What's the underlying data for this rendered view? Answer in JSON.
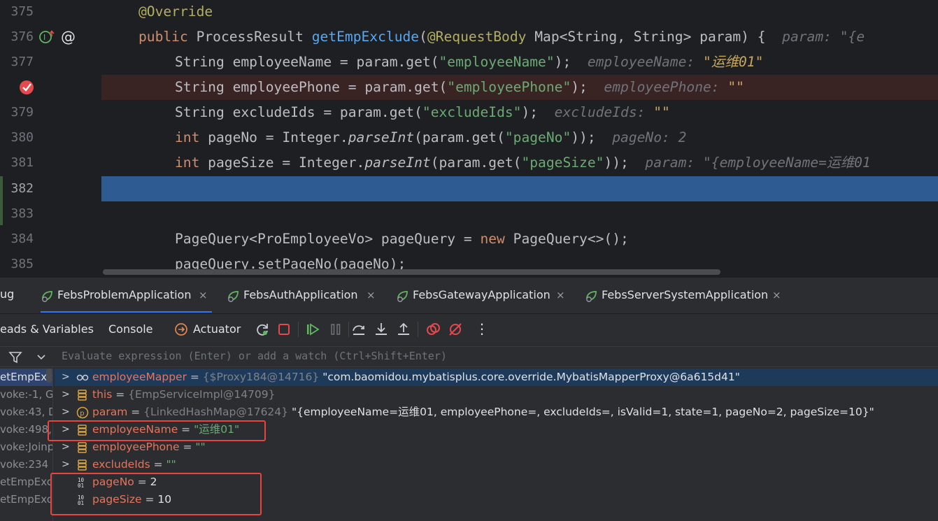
{
  "editor": {
    "lines": [
      {
        "num": "375"
      },
      {
        "num": "376"
      },
      {
        "num": "377"
      },
      {
        "num": ""
      },
      {
        "num": "379"
      },
      {
        "num": "380"
      },
      {
        "num": "381"
      },
      {
        "num": "382"
      },
      {
        "num": "383"
      },
      {
        "num": "384"
      },
      {
        "num": "385"
      }
    ],
    "code": {
      "l375_ann": "@Override",
      "l376_kw": "public",
      "l376_type": " ProcessResult ",
      "l376_fn": "getEmpExclude",
      "l376_p1": "(",
      "l376_ann": "@RequestBody",
      "l376_p2": " Map<String, String> param) {",
      "l376_hint": "  param: \"{e",
      "l377_a": "String employeeName = param.get(",
      "l377_str": "\"employeeName\"",
      "l377_b": ");",
      "l377_hint": "  employeeName: ",
      "l377_hintval": "\"运维01\"",
      "l378_a": "String employeePhone = param.get(",
      "l378_str": "\"employeePhone\"",
      "l378_b": ");",
      "l378_hint": "  employeePhone: ",
      "l378_hintval": "\"\"",
      "l379_a": "String excludeIds = param.get(",
      "l379_str": "\"excludeIds\"",
      "l379_b": ");",
      "l379_hint": "  excludeIds: ",
      "l379_hintval": "\"\"",
      "l380_kw": "int",
      "l380_a": " pageNo = Integer.",
      "l380_it": "parseInt",
      "l380_b": "(param.get(",
      "l380_str": "\"pageNo\"",
      "l380_c": "));",
      "l380_hint": "  pageNo: 2",
      "l381_kw": "int",
      "l381_a": " pageSize = Integer.",
      "l381_it": "parseInt",
      "l381_b": "(param.get(",
      "l381_str": "\"pageSize\"",
      "l381_c": "));",
      "l381_hint": "  param: \"{employeeName=运维01",
      "l384_a": "PageQuery<ProEmployeeVo> pageQuery = ",
      "l384_kw": "new",
      "l384_b": " PageQuery<>();",
      "l385_a": "pageQuery.setPageNo(pageNo);"
    }
  },
  "debug": {
    "tool_title": "ug",
    "run_tabs": [
      {
        "label": "FebsProblemApplication",
        "close": "×"
      },
      {
        "label": "FebsAuthApplication",
        "close": "×"
      },
      {
        "label": "FebsGatewayApplication",
        "close": "×"
      },
      {
        "label": "FebsServerSystemApplication",
        "close": "×"
      }
    ],
    "toolbar": {
      "threads_tab": "eads & Variables",
      "console_tab": "Console",
      "actuator_tab": "Actuator",
      "more": "⋮"
    },
    "eval_placeholder": "Evaluate expression (Enter) or add a watch (Ctrl+Shift+Enter)",
    "frames": [
      "etEmpExcl",
      "voke:-1, G",
      "voke:43, D",
      "voke:498,",
      "voke:Joinp",
      "voke:234",
      "etEmpExcl",
      "etEmpExcl"
    ],
    "variables": [
      {
        "chev": ">",
        "name": "employeeMapper",
        "eq": " = ",
        "type": "{$Proxy184@14716} ",
        "value": "\"com.baomidou.mybatisplus.core.override.MybatisMapperProxy@6a615d41\"",
        "icon": "watch-icon"
      },
      {
        "chev": ">",
        "name": "this",
        "eq": " = ",
        "type": "{EmpServiceImpl@14709}",
        "value": "",
        "icon": "field-icon"
      },
      {
        "chev": ">",
        "name": "param",
        "eq": " = ",
        "type": "{LinkedHashMap@17624} ",
        "value": "\"{employeeName=运维01, employeePhone=, excludeIds=, isValid=1, state=1, pageNo=2, pageSize=10}\"",
        "icon": "parameter-icon"
      },
      {
        "chev": ">",
        "name": "employeeName",
        "eq": " = ",
        "type": "",
        "value": "\"运维01\"",
        "icon": "field-icon"
      },
      {
        "chev": ">",
        "name": "employeePhone",
        "eq": " = ",
        "type": "",
        "value": "\"\"",
        "icon": "field-icon"
      },
      {
        "chev": ">",
        "name": "excludeIds",
        "eq": " = ",
        "type": "",
        "value": "\"\"",
        "icon": "field-icon"
      },
      {
        "chev": "",
        "name": "pageNo",
        "eq": " = ",
        "type": "",
        "value": "2",
        "icon": "primitive-icon"
      },
      {
        "chev": "",
        "name": "pageSize",
        "eq": " = ",
        "type": "",
        "value": "10",
        "icon": "primitive-icon"
      }
    ]
  },
  "colors": {
    "accent": "#3574f0",
    "current_line": "#2f5b93",
    "breakpoint": "#e5484d",
    "highlight_box": "#e9443f"
  }
}
